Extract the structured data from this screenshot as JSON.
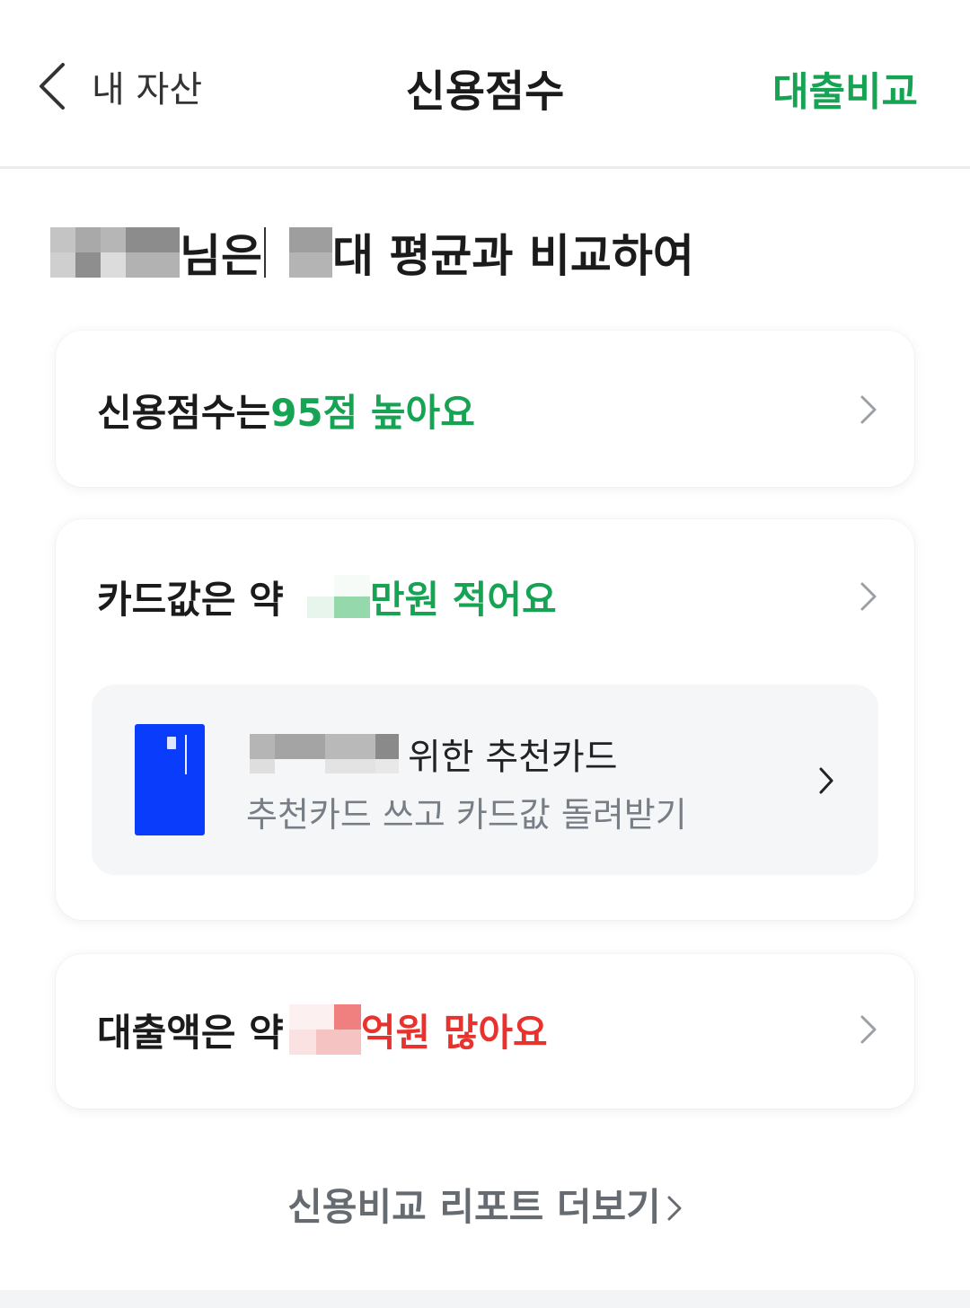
{
  "header": {
    "back_label": "내 자산",
    "title": "신용점수",
    "action_label": "대출비교"
  },
  "headline": {
    "suffix_after_name": "님은",
    "suffix_after_age": "대 평균과 비교하여"
  },
  "rows": {
    "credit": {
      "prefix": "신용점수는 ",
      "highlight": "95점 높아요"
    },
    "card": {
      "prefix": "카드값은 약 ",
      "highlight": "만원 적어요"
    },
    "loan": {
      "prefix": "대출액은 약 ",
      "highlight": "억원 많아요"
    }
  },
  "recommend": {
    "title_suffix": "위한 추천카드",
    "subtitle": "추천카드 쓰고 카드값 돌려받기"
  },
  "more_link": "신용비교 리포트 더보기",
  "colors": {
    "green": "#17a354",
    "red": "#e8322e",
    "card_blue": "#0a3dfb"
  }
}
